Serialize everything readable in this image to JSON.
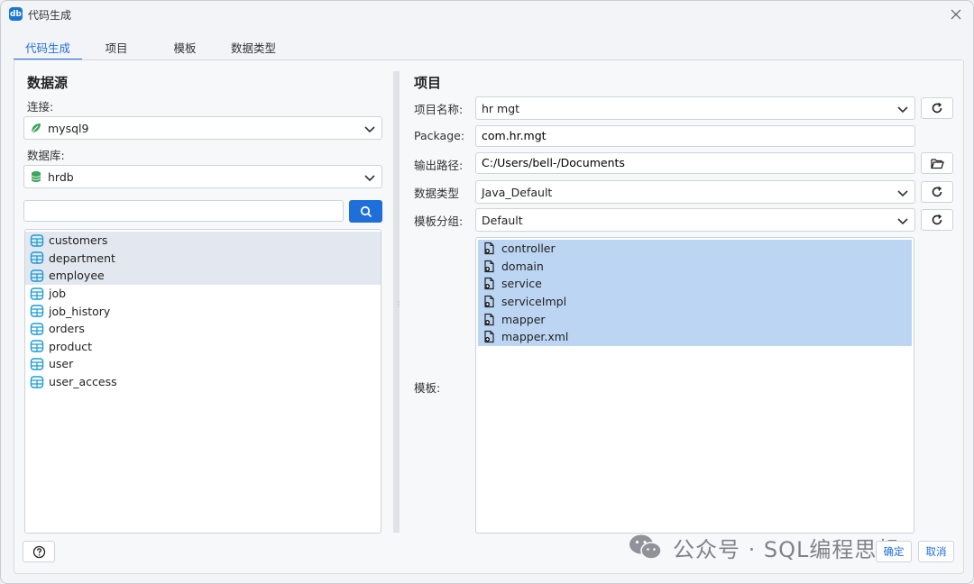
{
  "window": {
    "title": "代码生成",
    "app_icon_text": "db"
  },
  "tabs": [
    {
      "label": "代码生成",
      "active": true
    },
    {
      "label": "项目",
      "active": false
    },
    {
      "label": "模板",
      "active": false
    },
    {
      "label": "数据类型",
      "active": false
    }
  ],
  "datasource": {
    "section_title": "数据源",
    "connection_label": "连接:",
    "connection_value": "mysql9",
    "database_label": "数据库:",
    "database_value": "hrdb",
    "search_value": "",
    "tables": [
      {
        "name": "customers",
        "selected": true
      },
      {
        "name": "department",
        "selected": true
      },
      {
        "name": "employee",
        "selected": true
      },
      {
        "name": "job",
        "selected": false
      },
      {
        "name": "job_history",
        "selected": false
      },
      {
        "name": "orders",
        "selected": false
      },
      {
        "name": "product",
        "selected": false
      },
      {
        "name": "user",
        "selected": false
      },
      {
        "name": "user_access",
        "selected": false
      }
    ]
  },
  "project": {
    "section_title": "项目",
    "name_label": "项目名称:",
    "name_value": "hr mgt",
    "package_label": "Package:",
    "package_value": "com.hr.mgt",
    "output_label": "输出路径:",
    "output_value": "C:/Users/bell-/Documents",
    "datatype_label": "数据类型",
    "datatype_value": "Java_Default",
    "template_group_label": "模板分组:",
    "template_group_value": "Default",
    "templates_label": "模板:",
    "templates": [
      "controller",
      "domain",
      "service",
      "serviceImpl",
      "mapper",
      "mapper.xml"
    ]
  },
  "footer": {
    "ok_label": "确定",
    "cancel_label": "取消"
  },
  "watermark": {
    "text": "公众号 · SQL编程思想"
  },
  "colors": {
    "accent": "#1e6fd9",
    "selection": "#bcd5f3",
    "table_icon": "#1a9bd7"
  }
}
